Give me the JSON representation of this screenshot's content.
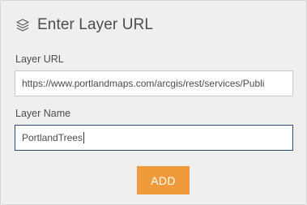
{
  "dialog": {
    "title": "Enter Layer URL",
    "icon": "layers-icon"
  },
  "form": {
    "url_label": "Layer URL",
    "url_value": "https://www.portlandmaps.com/arcgis/rest/services/Publi",
    "name_label": "Layer Name",
    "name_value": "PortlandTrees",
    "add_label": "ADD"
  },
  "colors": {
    "panel_bg": "#efefef",
    "add_button": "#ef9a3b",
    "focused_border": "#2b4c74"
  }
}
